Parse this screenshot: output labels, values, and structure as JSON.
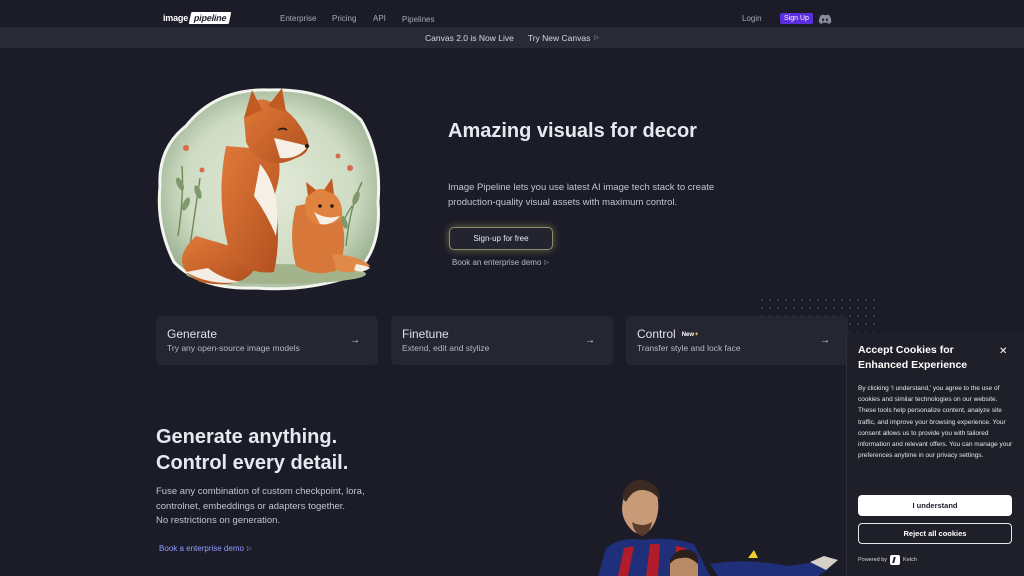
{
  "nav": {
    "logo": {
      "word1": "image",
      "word2": "pipeline"
    },
    "links": [
      "Enterprise",
      "Pricing",
      "API",
      "Pipelines"
    ],
    "login": "Login",
    "signup": "Sign Up",
    "discord_icon": "discord-icon"
  },
  "banner": {
    "title": "Canvas 2.0 is Now Live",
    "cta": "Try New Canvas",
    "cta_icon": "play-triangle-icon"
  },
  "hero": {
    "title": "Amazing visuals for decor",
    "description": "Image Pipeline lets you use latest AI image tech stack to create production-quality visual assets with maximum control.",
    "cta": "Sign-up for free",
    "secondary_link": "Book an enterprise demo",
    "image": "fox-mother-and-cub-illustration"
  },
  "features": [
    {
      "title": "Generate",
      "subtitle": "Try any open-source image models",
      "badge": "",
      "icon": "arrow-right-icon"
    },
    {
      "title": "Finetune",
      "subtitle": "Extend, edit and stylize",
      "badge": "",
      "icon": "arrow-right-icon"
    },
    {
      "title": "Control",
      "subtitle": "Transfer style and lock face",
      "badge": "New",
      "icon": "arrow-right-icon"
    }
  ],
  "section2": {
    "title_line1": "Generate anything.",
    "title_line2": "Control every detail.",
    "description_line1": "Fuse any combination of custom checkpoint, lora,",
    "description_line2": "controlnet, embeddings or adapters together.",
    "description_line3": "No restrictions on generation.",
    "link": "Book a enterprise demo",
    "image": "football-player-collage"
  },
  "cookie": {
    "title": "Accept Cookies for Enhanced Experience",
    "body": "By clicking ‘I understand,’ you agree to the use of cookies and similar technologies on our website. These tools help personalize content, analyze site traffic, and improve your browsing experience. Your consent allows us to provide you with tailored information and relevant offers. You can manage your preferences anytime in our privacy settings.",
    "accept": "I understand",
    "reject": "Reject all cookies",
    "powered_by": "Powered by",
    "brand": "Ketch"
  },
  "colors": {
    "background": "#1c1c28",
    "signup_accent": "#5b2ee0",
    "link_accent": "#8f9bff",
    "cta_glow": "#c8d25a"
  }
}
